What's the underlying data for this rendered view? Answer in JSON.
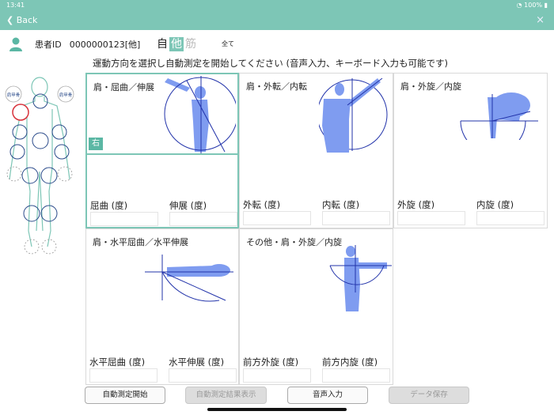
{
  "status": {
    "time": "13:41",
    "battery": "100%"
  },
  "nav": {
    "back": "Back",
    "close": "×"
  },
  "patient": {
    "id_label": "患者ID",
    "id_value": "0000000123[他]"
  },
  "mode": {
    "self": "自",
    "other": "他",
    "muscle": "筋",
    "all": "全て"
  },
  "instruction": "運動方向を選択し自動測定を開始してください (音声入力、キーボード入力も可能です)",
  "body_map": {
    "scapula_left": "肩甲骨",
    "scapula_right": "肩甲骨"
  },
  "panels": [
    {
      "title": "肩・屈曲／伸展",
      "side": "右",
      "field1": "屈曲 (度)",
      "field2": "伸展 (度)"
    },
    {
      "title": "肩・外転／内転",
      "field1": "外転 (度)",
      "field2": "内転 (度)"
    },
    {
      "title": "肩・外旋／内旋",
      "field1": "外旋 (度)",
      "field2": "内旋 (度)"
    },
    {
      "title": "肩・水平屈曲／水平伸展",
      "field1": "水平屈曲 (度)",
      "field2": "水平伸展 (度)"
    },
    {
      "title": "その他・肩・外旋／内旋",
      "field1": "前方外旋 (度)",
      "field2": "前方内旋 (度)"
    }
  ],
  "buttons": {
    "start": "自動測定開始",
    "results": "自動測定結果表示",
    "voice": "音声入力",
    "save": "データ保存"
  },
  "colors": {
    "accent": "#7dc6b6",
    "figure": "#7f9cf0",
    "line": "#2233aa"
  }
}
